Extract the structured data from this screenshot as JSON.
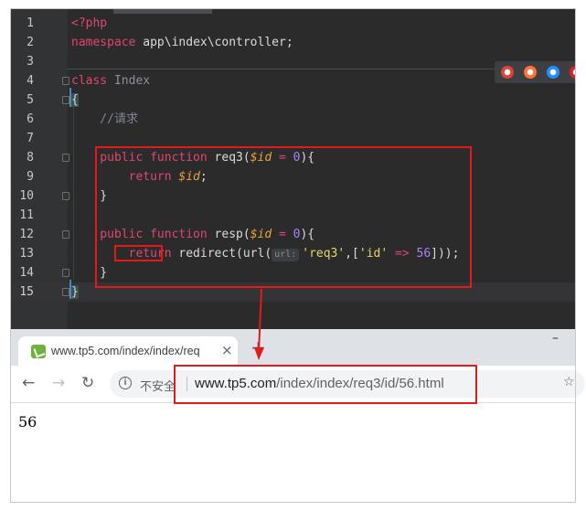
{
  "editor": {
    "lines": [
      {
        "n": "1",
        "tokens": [
          {
            "t": "<?php",
            "c": "kw"
          }
        ]
      },
      {
        "n": "2",
        "tokens": [
          {
            "t": "namespace ",
            "c": "kw"
          },
          {
            "t": "app\\index\\controller;",
            "c": "fn"
          }
        ]
      },
      {
        "n": "3",
        "tokens": []
      },
      {
        "n": "4",
        "tokens": [
          {
            "t": "class ",
            "c": "kw"
          },
          {
            "t": "Index",
            "c": "cls"
          }
        ]
      },
      {
        "n": "5",
        "tokens": [
          {
            "t": "{",
            "c": "brace-hl"
          }
        ]
      },
      {
        "n": "6",
        "tokens": [
          {
            "t": "    //请求",
            "c": "cmt"
          }
        ]
      },
      {
        "n": "7",
        "tokens": []
      },
      {
        "n": "8",
        "tokens": [
          {
            "t": "    public ",
            "c": "kw"
          },
          {
            "t": "function ",
            "c": "kw"
          },
          {
            "t": "req3(",
            "c": "fn"
          },
          {
            "t": "$id",
            "c": "var"
          },
          {
            "t": " = ",
            "c": "op"
          },
          {
            "t": "0",
            "c": "num"
          },
          {
            "t": "){",
            "c": "fn"
          }
        ]
      },
      {
        "n": "9",
        "tokens": [
          {
            "t": "        return ",
            "c": "kw"
          },
          {
            "t": "$id",
            "c": "var"
          },
          {
            "t": ";",
            "c": "fn"
          }
        ]
      },
      {
        "n": "10",
        "tokens": [
          {
            "t": "    }",
            "c": "fn"
          }
        ]
      },
      {
        "n": "11",
        "tokens": []
      },
      {
        "n": "12",
        "tokens": [
          {
            "t": "    public ",
            "c": "kw"
          },
          {
            "t": "function ",
            "c": "kw"
          },
          {
            "t": "resp(",
            "c": "fn"
          },
          {
            "t": "$id",
            "c": "var"
          },
          {
            "t": " = ",
            "c": "op"
          },
          {
            "t": "0",
            "c": "num"
          },
          {
            "t": "){",
            "c": "fn"
          }
        ]
      },
      {
        "n": "13",
        "tokens": [
          {
            "t": "        return ",
            "c": "kw"
          },
          {
            "t": "redirect(url(",
            "c": "fn"
          },
          {
            "t": "url:",
            "c": "hint"
          },
          {
            "t": "'req3'",
            "c": "str"
          },
          {
            "t": ",[",
            "c": "fn"
          },
          {
            "t": "'id'",
            "c": "str"
          },
          {
            "t": " => ",
            "c": "op"
          },
          {
            "t": "56",
            "c": "num"
          },
          {
            "t": "]));",
            "c": "fn"
          }
        ]
      },
      {
        "n": "14",
        "tokens": [
          {
            "t": "    }",
            "c": "fn"
          }
        ]
      },
      {
        "n": "15",
        "tokens": [
          {
            "t": "}",
            "c": "brace-hl"
          }
        ]
      }
    ],
    "current_line": "15",
    "browser_icons": [
      {
        "name": "chrome-icon",
        "color": "#db4437"
      },
      {
        "name": "firefox-icon",
        "color": "#ff7139"
      },
      {
        "name": "safari-icon",
        "color": "#1e90ff"
      },
      {
        "name": "opera-icon",
        "color": "#e01f2d"
      }
    ]
  },
  "browser": {
    "tab_title": "www.tp5.com/index/index/req",
    "tab_close": "×",
    "new_tab": "+",
    "minimize": "–",
    "back": "←",
    "forward": "→",
    "reload": "↻",
    "info": "i",
    "security_label": "不安全",
    "url_host": "www.tp5.com",
    "url_path": "/index/index/req3/id/56.html",
    "bookmark": "☆",
    "page_text": "56"
  },
  "colors": {
    "editor_bg": "#2b2b2b",
    "annotation": "#e21a1a",
    "favicon": "#6db33f"
  }
}
